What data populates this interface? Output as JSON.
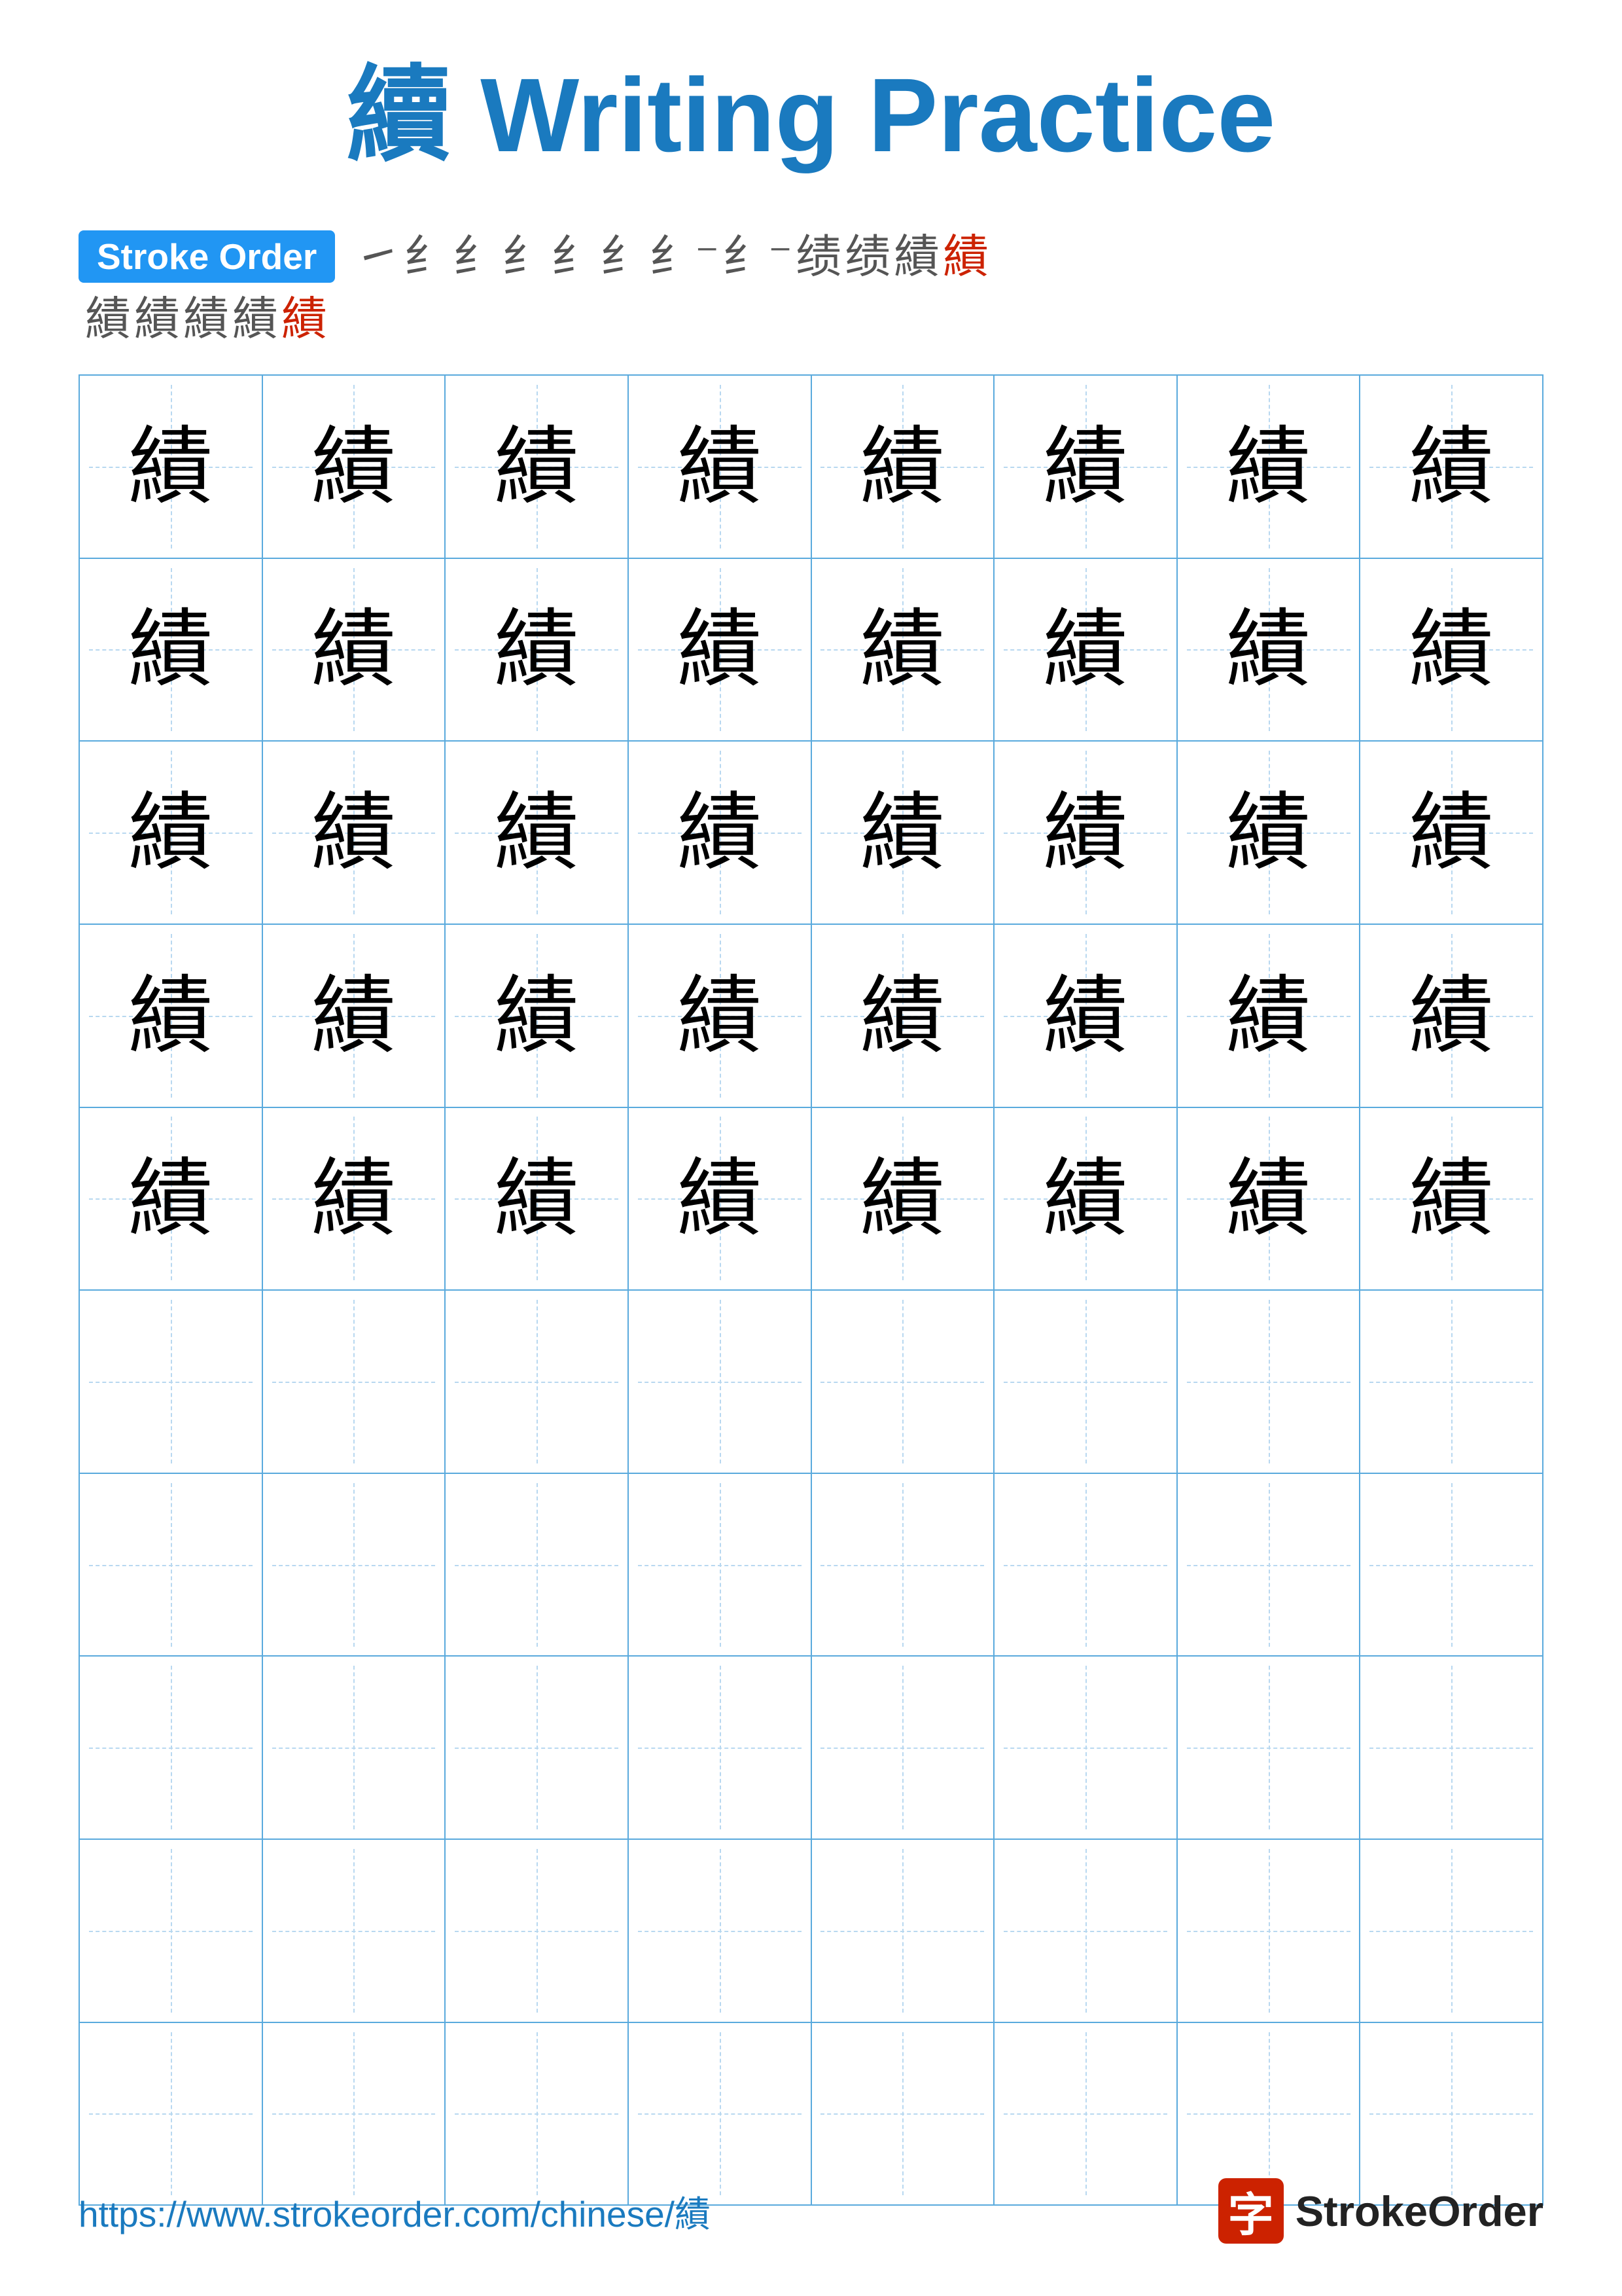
{
  "page": {
    "title": {
      "char": "續",
      "text": " Writing Practice"
    },
    "stroke_order": {
      "badge_label": "Stroke Order",
      "strokes": [
        "㇀",
        "纟",
        "纟",
        "纟",
        "纟",
        "纟",
        "纟⁻",
        "纟⁻",
        "続",
        "続",
        "績",
        "績"
      ],
      "row2": [
        "績",
        "績",
        "績",
        "績",
        "績"
      ]
    },
    "character": "績",
    "grid": {
      "rows": 10,
      "cols": 8
    },
    "footer": {
      "url": "https://www.strokeorder.com/chinese/績",
      "logo_char": "字",
      "logo_text": "StrokeOrder"
    }
  }
}
